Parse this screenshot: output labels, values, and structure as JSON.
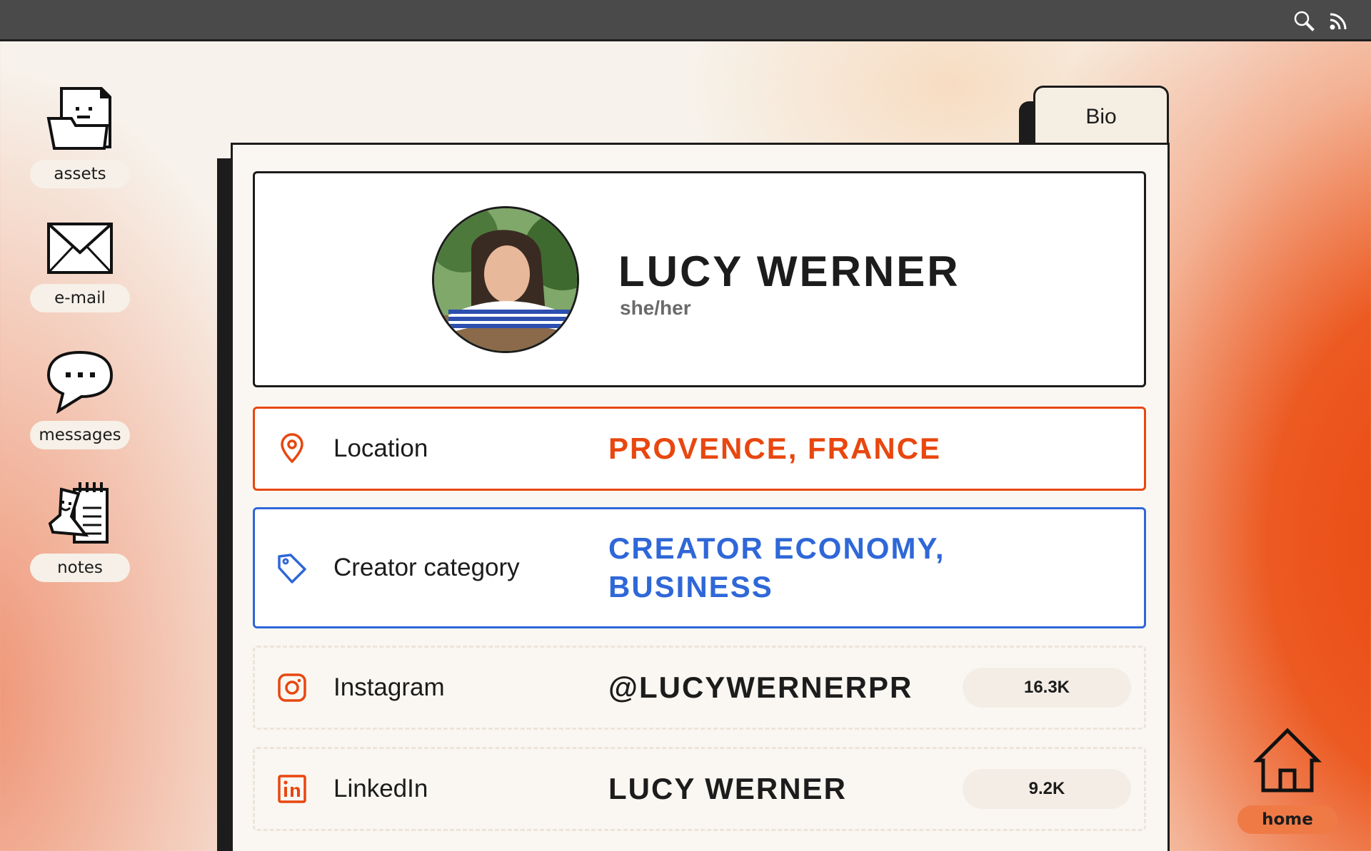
{
  "topbar": {
    "icons": [
      "search-icon",
      "rss-icon"
    ]
  },
  "desktop": {
    "items": [
      {
        "label": "assets",
        "icon": "folder-face-icon"
      },
      {
        "label": "e-mail",
        "icon": "envelope-icon"
      },
      {
        "label": "messages",
        "icon": "speech-bubble-icon"
      },
      {
        "label": "notes",
        "icon": "notepad-icon"
      }
    ],
    "home": {
      "label": "home",
      "icon": "house-icon"
    }
  },
  "window": {
    "tab": "Bio",
    "profile": {
      "name": "LUCY WERNER",
      "pronouns": "she/her"
    },
    "rows": {
      "location": {
        "label": "Location",
        "value": "PROVENCE, FRANCE",
        "icon": "map-pin-icon"
      },
      "category": {
        "label": "Creator category",
        "value": "CREATOR ECONOMY, BUSINESS",
        "icon": "tag-icon"
      },
      "instagram": {
        "label": "Instagram",
        "value": "@LUCYWERNERPR",
        "count": "16.3K",
        "icon": "instagram-icon"
      },
      "linkedin": {
        "label": "LinkedIn",
        "value": "LUCY WERNER",
        "count": "9.2K",
        "icon": "linkedin-icon"
      }
    }
  },
  "colors": {
    "accent_orange": "#e8470f",
    "accent_blue": "#2f67d8",
    "ink": "#1c1c1c"
  }
}
